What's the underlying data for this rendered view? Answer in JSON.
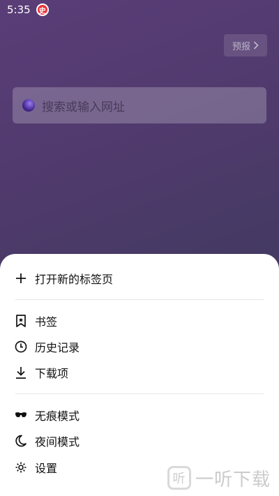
{
  "status_bar": {
    "time": "5:35",
    "badge": "史"
  },
  "forecast_button": {
    "label": "预报",
    "chevron": "›"
  },
  "search": {
    "placeholder": "搜索或输入网址",
    "icon": "planet-icon"
  },
  "menu": {
    "new_tab": {
      "label": "打开新的标签页",
      "icon": "plus-icon"
    },
    "bookmarks": {
      "label": "书签",
      "icon": "bookmark-icon"
    },
    "history": {
      "label": "历史记录",
      "icon": "clock-icon"
    },
    "downloads": {
      "label": "下载项",
      "icon": "download-icon"
    },
    "incognito": {
      "label": "无痕模式",
      "icon": "incognito-mask-icon"
    },
    "night_mode": {
      "label": "夜间模式",
      "icon": "moon-icon"
    },
    "settings": {
      "label": "设置",
      "icon": "gear-icon"
    }
  },
  "watermark": {
    "logo": "听",
    "text": "一听下载"
  }
}
